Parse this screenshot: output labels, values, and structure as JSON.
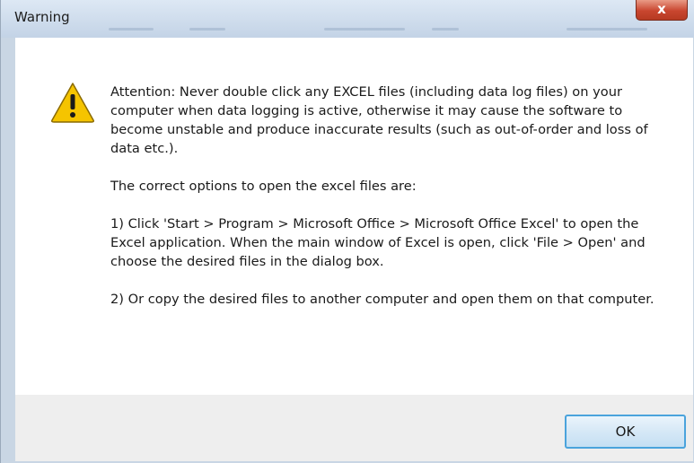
{
  "window": {
    "title": "Warning",
    "close_glyph": "x"
  },
  "message": {
    "icon": "warning-icon",
    "paragraphs": [
      "Attention: Never double click any EXCEL files (including data log files) on your computer when data logging is active, otherwise it may cause the software to become unstable and produce inaccurate results (such as out-of-order and loss of data etc.).",
      "The correct options to open the excel files are:",
      "1) Click 'Start > Program > Microsoft Office > Microsoft Office Excel' to open the Excel application. When the main window of Excel is open, click 'File > Open' and choose the desired files in the dialog box.",
      "2) Or copy the desired files to another computer and open them on that computer."
    ]
  },
  "buttons": {
    "ok_label": "OK"
  },
  "colors": {
    "warning_yellow": "#f5c400",
    "close_red": "#c9462f",
    "ok_border": "#4aa3dc"
  }
}
